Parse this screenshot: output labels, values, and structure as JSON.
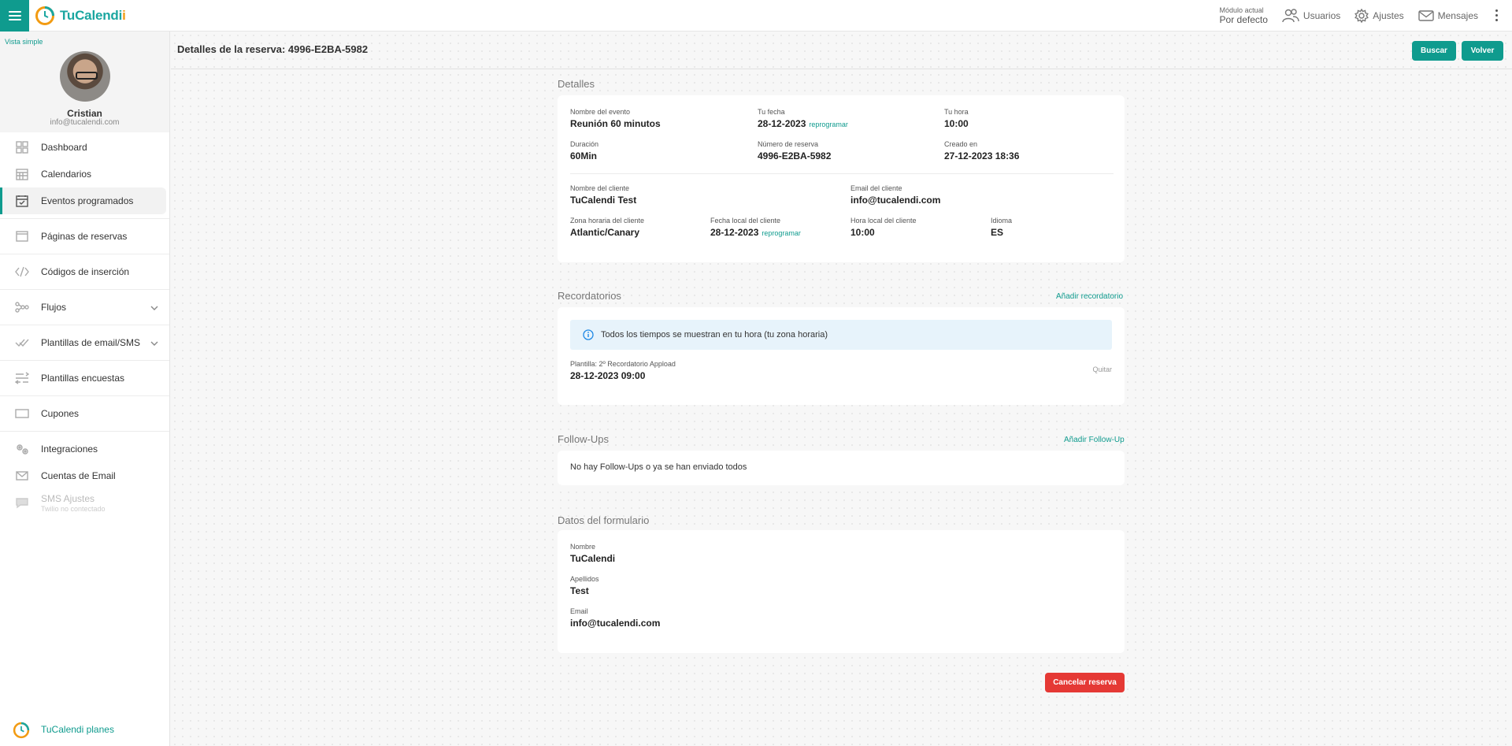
{
  "topbar": {
    "brand_tu": "Tu",
    "brand_calendi": "Calendi",
    "brand_i": "i",
    "module_label": "Módulo actual",
    "module_value": "Por defecto",
    "users": "Usuarios",
    "settings": "Ajustes",
    "messages": "Mensajes"
  },
  "sidebar": {
    "vista": "Vista simple",
    "name": "Cristian",
    "email": "info@tucalendi.com",
    "items": [
      {
        "label": "Dashboard"
      },
      {
        "label": "Calendarios"
      },
      {
        "label": "Eventos programados"
      },
      {
        "label": "Páginas de reservas"
      },
      {
        "label": "Códigos de inserción"
      },
      {
        "label": "Flujos"
      },
      {
        "label": "Plantillas de email/SMS"
      },
      {
        "label": "Plantillas encuestas"
      },
      {
        "label": "Cupones"
      },
      {
        "label": "Integraciones"
      },
      {
        "label": "Cuentas de Email"
      },
      {
        "label": "SMS Ajustes",
        "sub": "Twilio no contectado"
      }
    ],
    "plans": "TuCalendi planes"
  },
  "page": {
    "title": "Detalles de la reserva: 4996-E2BA-5982",
    "search_btn": "Buscar",
    "back_btn": "Volver"
  },
  "details": {
    "title": "Detalles",
    "event_name_label": "Nombre del evento",
    "event_name": "Reunión 60 minutos",
    "your_date_label": "Tu fecha",
    "your_date": "28-12-2023",
    "reschedule": "reprogramar",
    "your_time_label": "Tu hora",
    "your_time": "10:00",
    "duration_label": "Duración",
    "duration": "60Min",
    "booking_no_label": "Número de reserva",
    "booking_no": "4996-E2BA-5982",
    "created_label": "Creado en",
    "created": "27-12-2023 18:36",
    "client_name_label": "Nombre del cliente",
    "client_name": "TuCalendi Test",
    "client_email_label": "Email del cliente",
    "client_email": "info@tucalendi.com",
    "client_tz_label": "Zona horaria del cliente",
    "client_tz": "Atlantic/Canary",
    "client_date_label": "Fecha local del cliente",
    "client_date": "28-12-2023",
    "client_time_label": "Hora local del cliente",
    "client_time": "10:00",
    "language_label": "Idioma",
    "language": "ES"
  },
  "reminders": {
    "title": "Recordatorios",
    "add": "Añadir recordatorio",
    "info": "Todos los tiempos se muestran en tu hora (tu zona horaria)",
    "template_label": "Plantilla: 2º Recordatorio Appload",
    "template_date": "28-12-2023 09:00",
    "remove": "Quitar"
  },
  "followups": {
    "title": "Follow-Ups",
    "add": "Añadir Follow-Up",
    "empty": "No hay Follow-Ups o ya se han enviado todos"
  },
  "form": {
    "title": "Datos del formulario",
    "name_label": "Nombre",
    "name": "TuCalendi",
    "surname_label": "Apellidos",
    "surname": "Test",
    "email_label": "Email",
    "email": "info@tucalendi.com"
  },
  "cancel_btn": "Cancelar reserva",
  "colors": {
    "accent": "#0f9b8e",
    "danger": "#e53935",
    "info_bg": "#e7f3fb"
  }
}
